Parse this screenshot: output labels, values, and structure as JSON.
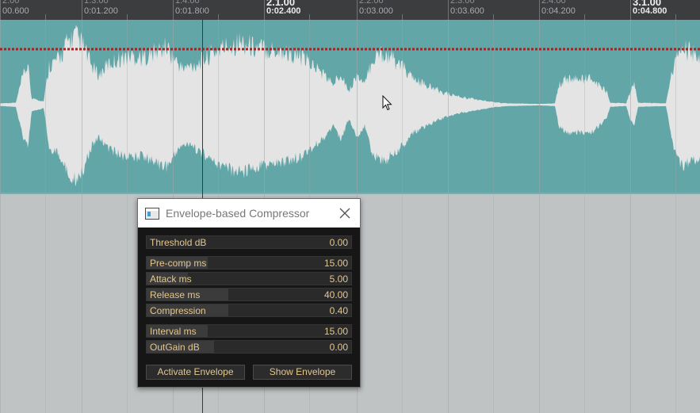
{
  "ruler": {
    "ticks": [
      {
        "top": "2.00",
        "bottom": "00.600"
      },
      {
        "top": "1.3.00",
        "bottom": "0:01.200"
      },
      {
        "top": "1.4.00",
        "bottom": "0:01.800"
      },
      {
        "top": "2.1.00",
        "bottom": "0:02.400",
        "major": true
      },
      {
        "top": "2.2.00",
        "bottom": "0:03.000"
      },
      {
        "top": "2.3.00",
        "bottom": "0:03.600"
      },
      {
        "top": "2.4.00",
        "bottom": "0:04.200"
      },
      {
        "top": "3.1.00",
        "bottom": "0:04.800",
        "major": true
      }
    ]
  },
  "colors": {
    "waveform_bg": "#62a6a7",
    "waveform_fill": "#e4e4e4",
    "envelope": "#b01f1f",
    "playhead": "#7a1e1e",
    "lane_bg": "#bfc3c4",
    "dialog_bg": "#161616",
    "param_text": "#e3c78f"
  },
  "dialog": {
    "title": "Envelope-based Compressor",
    "icons": {
      "app": "app-window-icon",
      "close": "close-icon"
    },
    "params": [
      {
        "id": "threshold",
        "label": "Threshold dB",
        "value": "0.00",
        "level": 0.0
      },
      {
        "id": "precomp",
        "label": "Pre-comp ms",
        "value": "15.00",
        "level": 0.3
      },
      {
        "id": "attack",
        "label": "Attack ms",
        "value": "5.00",
        "level": 0.2
      },
      {
        "id": "release",
        "label": "Release ms",
        "value": "40.00",
        "level": 0.4
      },
      {
        "id": "compression",
        "label": "Compression",
        "value": "0.40",
        "level": 0.4
      },
      {
        "id": "interval",
        "label": "Interval ms",
        "value": "15.00",
        "level": 0.3
      },
      {
        "id": "outgain",
        "label": "OutGain dB",
        "value": "0.00",
        "level": 0.33
      }
    ],
    "buttons": {
      "activate": "Activate Envelope",
      "show": "Show Envelope"
    }
  }
}
